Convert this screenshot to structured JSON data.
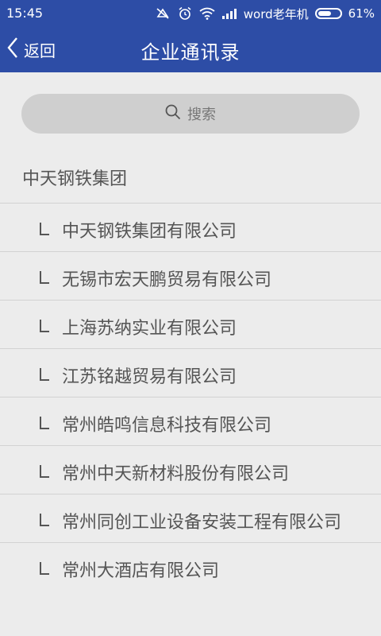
{
  "status_bar": {
    "time": "15:45",
    "carrier": "word老年机",
    "battery": "61%",
    "battery_level": 0.61,
    "icons": [
      "mute-icon",
      "alarm-icon",
      "wifi-icon",
      "signal-icon",
      "battery-icon"
    ]
  },
  "nav": {
    "back_label": "返回",
    "title": "企业通讯录"
  },
  "search": {
    "placeholder": "搜索"
  },
  "group": {
    "name": "中天钢铁集团"
  },
  "companies": [
    {
      "name": "中天钢铁集团有限公司"
    },
    {
      "name": "无锡市宏天鹏贸易有限公司"
    },
    {
      "name": "上海苏纳实业有限公司"
    },
    {
      "name": "江苏铭越贸易有限公司"
    },
    {
      "name": "常州皓鸣信息科技有限公司"
    },
    {
      "name": "常州中天新材料股份有限公司"
    },
    {
      "name": "常州同创工业设备安装工程有限公司"
    },
    {
      "name": "常州大酒店有限公司"
    }
  ],
  "colors": {
    "header_bg": "#2d4da6",
    "page_bg": "#ececec",
    "search_bg": "#cfcfcf",
    "text": "#555555"
  }
}
